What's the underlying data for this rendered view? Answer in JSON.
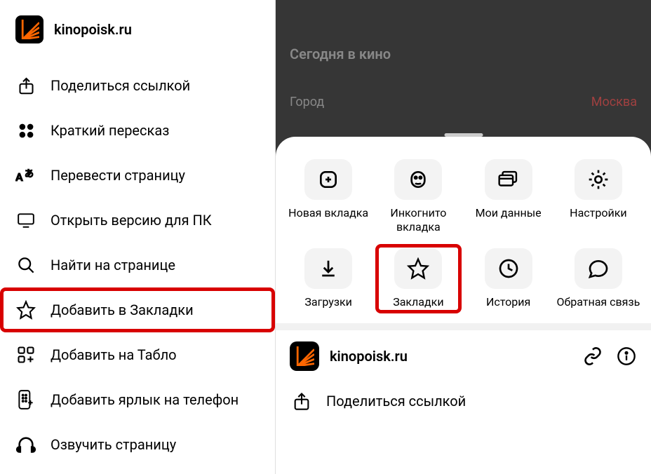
{
  "site": {
    "name": "kinopoisk.ru"
  },
  "leftMenu": {
    "items": [
      {
        "label": "Поделиться ссылкой"
      },
      {
        "label": "Краткий пересказ"
      },
      {
        "label": "Перевести страницу"
      },
      {
        "label": "Открыть версию для ПК"
      },
      {
        "label": "Найти на странице"
      },
      {
        "label": "Добавить в Закладки"
      },
      {
        "label": "Добавить на Табло"
      },
      {
        "label": "Добавить ярлык на телефон"
      },
      {
        "label": "Озвучить страницу"
      }
    ]
  },
  "rightDim": {
    "heading": "Сегодня в кино",
    "cityLabel": "Город",
    "cityValue": "Москва"
  },
  "tiles": [
    {
      "label": "Новая вкладка"
    },
    {
      "label": "Инкогнито вкладка"
    },
    {
      "label": "Мои данные"
    },
    {
      "label": "Настройки"
    },
    {
      "label": "Загрузки"
    },
    {
      "label": "Закладки"
    },
    {
      "label": "История"
    },
    {
      "label": "Обратная связь"
    }
  ],
  "sheetSite": {
    "name": "kinopoisk.ru"
  },
  "sheetShare": {
    "label": "Поделиться ссылкой"
  }
}
